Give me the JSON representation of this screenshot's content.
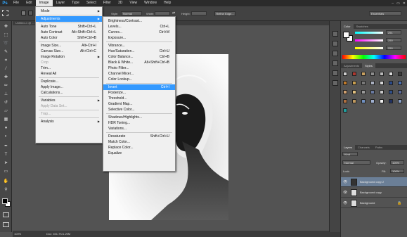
{
  "menubar": {
    "logo": "Ps",
    "items": [
      "File",
      "Edit",
      "Image",
      "Layer",
      "Type",
      "Select",
      "Filter",
      "3D",
      "View",
      "Window",
      "Help"
    ],
    "active_index": 2,
    "window_controls": [
      "–",
      "▭",
      "✕"
    ]
  },
  "options": {
    "style_label": "Style:",
    "style_value": "Normal",
    "width_label": "Width:",
    "height_label": "Height:",
    "refine_edge": "Refine Edge...",
    "workspace": "Essentials"
  },
  "doc_tabs": [
    {
      "label": "Untitled-1 @ ...",
      "active": false
    },
    {
      "label": "Untitled-...",
      "active": false
    },
    {
      "label": "...pg @ 46.7% (Layer 1, RGB/8) *",
      "active": true
    }
  ],
  "image_menu": [
    {
      "label": "Mode",
      "shortcut": "",
      "arrow": true,
      "disabled": false,
      "highlight": false
    },
    {
      "sep": true
    },
    {
      "label": "Adjustments",
      "shortcut": "",
      "arrow": true,
      "disabled": false,
      "highlight": true
    },
    {
      "sep": true
    },
    {
      "label": "Auto Tone",
      "shortcut": "Shift+Ctrl+L",
      "arrow": false,
      "disabled": false,
      "highlight": false
    },
    {
      "label": "Auto Contrast",
      "shortcut": "Alt+Shift+Ctrl+L",
      "arrow": false,
      "disabled": false,
      "highlight": false
    },
    {
      "label": "Auto Color",
      "shortcut": "Shift+Ctrl+B",
      "arrow": false,
      "disabled": false,
      "highlight": false
    },
    {
      "sep": true
    },
    {
      "label": "Image Size...",
      "shortcut": "Alt+Ctrl+I",
      "arrow": false,
      "disabled": false,
      "highlight": false
    },
    {
      "label": "Canvas Size...",
      "shortcut": "Alt+Ctrl+C",
      "arrow": false,
      "disabled": false,
      "highlight": false
    },
    {
      "label": "Image Rotation",
      "shortcut": "",
      "arrow": true,
      "disabled": false,
      "highlight": false
    },
    {
      "label": "Crop",
      "shortcut": "",
      "arrow": false,
      "disabled": true,
      "highlight": false
    },
    {
      "label": "Trim...",
      "shortcut": "",
      "arrow": false,
      "disabled": false,
      "highlight": false
    },
    {
      "label": "Reveal All",
      "shortcut": "",
      "arrow": false,
      "disabled": false,
      "highlight": false
    },
    {
      "sep": true
    },
    {
      "label": "Duplicate...",
      "shortcut": "",
      "arrow": false,
      "disabled": false,
      "highlight": false
    },
    {
      "label": "Apply Image...",
      "shortcut": "",
      "arrow": false,
      "disabled": false,
      "highlight": false
    },
    {
      "label": "Calculations...",
      "shortcut": "",
      "arrow": false,
      "disabled": false,
      "highlight": false
    },
    {
      "sep": true
    },
    {
      "label": "Variables",
      "shortcut": "",
      "arrow": true,
      "disabled": false,
      "highlight": false
    },
    {
      "label": "Apply Data Set...",
      "shortcut": "",
      "arrow": false,
      "disabled": true,
      "highlight": false
    },
    {
      "sep": true
    },
    {
      "label": "Trap...",
      "shortcut": "",
      "arrow": false,
      "disabled": true,
      "highlight": false
    },
    {
      "sep": true
    },
    {
      "label": "Analysis",
      "shortcut": "",
      "arrow": true,
      "disabled": false,
      "highlight": false
    }
  ],
  "adjustments_menu": [
    {
      "label": "Brightness/Contrast...",
      "shortcut": "",
      "highlight": false
    },
    {
      "label": "Levels...",
      "shortcut": "Ctrl+L",
      "highlight": false
    },
    {
      "label": "Curves...",
      "shortcut": "Ctrl+M",
      "highlight": false
    },
    {
      "label": "Exposure...",
      "shortcut": "",
      "highlight": false
    },
    {
      "sep": true
    },
    {
      "label": "Vibrance...",
      "shortcut": "",
      "highlight": false
    },
    {
      "label": "Hue/Saturation...",
      "shortcut": "Ctrl+U",
      "highlight": false
    },
    {
      "label": "Color Balance...",
      "shortcut": "Ctrl+B",
      "highlight": false
    },
    {
      "label": "Black & White...",
      "shortcut": "Alt+Shift+Ctrl+B",
      "highlight": false
    },
    {
      "label": "Photo Filter...",
      "shortcut": "",
      "highlight": false
    },
    {
      "label": "Channel Mixer...",
      "shortcut": "",
      "highlight": false
    },
    {
      "label": "Color Lookup...",
      "shortcut": "",
      "highlight": false
    },
    {
      "sep": true
    },
    {
      "label": "Invert",
      "shortcut": "Ctrl+I",
      "highlight": true
    },
    {
      "label": "Posterize...",
      "shortcut": "",
      "highlight": false
    },
    {
      "label": "Threshold...",
      "shortcut": "",
      "highlight": false
    },
    {
      "label": "Gradient Map...",
      "shortcut": "",
      "highlight": false
    },
    {
      "label": "Selective Color...",
      "shortcut": "",
      "highlight": false
    },
    {
      "sep": true
    },
    {
      "label": "Shadows/Highlights...",
      "shortcut": "",
      "highlight": false
    },
    {
      "label": "HDR Toning...",
      "shortcut": "",
      "highlight": false
    },
    {
      "label": "Variations...",
      "shortcut": "",
      "highlight": false
    },
    {
      "sep": true
    },
    {
      "label": "Desaturate",
      "shortcut": "Shift+Ctrl+U",
      "highlight": false
    },
    {
      "label": "Match Color...",
      "shortcut": "",
      "highlight": false
    },
    {
      "label": "Replace Color...",
      "shortcut": "",
      "highlight": false
    },
    {
      "label": "Equalize",
      "shortcut": "",
      "highlight": false
    }
  ],
  "color_panel": {
    "tabs": [
      "Color",
      "Swatches"
    ],
    "r": "251",
    "g": "250",
    "b": "250"
  },
  "adjustments_panel": {
    "tabs": [
      "Adjustments",
      "Styles"
    ]
  },
  "layers_panel": {
    "tabs": [
      "Layers",
      "Channels",
      "Paths"
    ],
    "kind_label": "Kind",
    "blend_mode": "Normal",
    "opacity_label": "Opacity:",
    "opacity_value": "100%",
    "lock_label": "Lock:",
    "fill_label": "Fill:",
    "fill_value": "100%",
    "layers": [
      {
        "name": "Background copy 2",
        "selected": true,
        "locked": false
      },
      {
        "name": "Background copy",
        "selected": false,
        "locked": false
      },
      {
        "name": "Background",
        "selected": false,
        "locked": true
      }
    ]
  },
  "status": {
    "zoom": "100%",
    "doc_info": "Doc: 451.7K/1.20M"
  },
  "colors": {
    "menu_highlight": "#3399ff",
    "selected_layer": "#6b7f97"
  }
}
